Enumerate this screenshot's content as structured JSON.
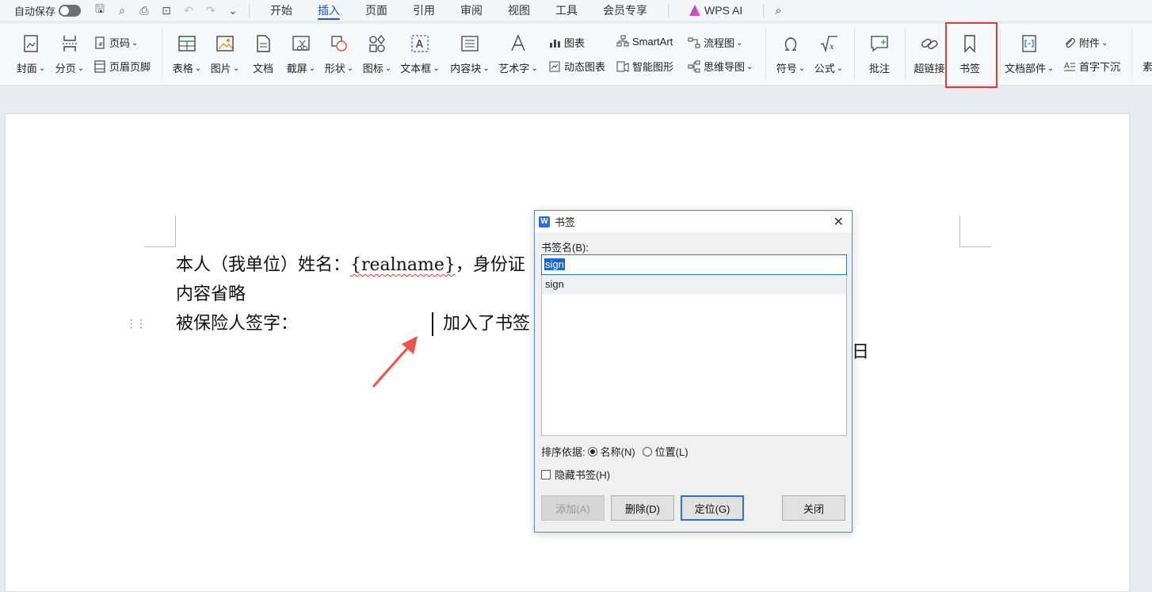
{
  "menubar": {
    "autosave_label": "自动保存",
    "tabs": [
      {
        "label": "开始",
        "active": false
      },
      {
        "label": "插入",
        "active": true
      },
      {
        "label": "页面",
        "active": false
      },
      {
        "label": "引用",
        "active": false
      },
      {
        "label": "审阅",
        "active": false
      },
      {
        "label": "视图",
        "active": false
      },
      {
        "label": "工具",
        "active": false
      },
      {
        "label": "会员专享",
        "active": false
      }
    ],
    "wps_ai_label": "WPS AI"
  },
  "ribbon": {
    "cover": "封面",
    "pagebreak": "分页",
    "page_number": "页码",
    "header_footer": "页眉页脚",
    "table": "表格",
    "picture": "图片",
    "document": "文档",
    "screenshot": "截屏",
    "shape": "形状",
    "icon": "图标",
    "textbox": "文本框",
    "content_block": "内容块",
    "wordart": "艺术字",
    "chart": "图表",
    "dynamic_chart": "动态图表",
    "smartart": "SmartArt",
    "smart_graphic": "智能图形",
    "flowchart": "流程图",
    "mindmap": "思维导图",
    "symbol": "符号",
    "formula": "公式",
    "comment": "批注",
    "hyperlink": "超链接",
    "bookmark": "书签",
    "doc_parts": "文档部件",
    "attachment": "附件",
    "drop_cap": "首字下沉",
    "cut_label": "素"
  },
  "document": {
    "line1_prefix": "本人（我单位）姓名：",
    "line1_field": "{realname}",
    "line1_suffix": "，身份证",
    "line2": "内容省略",
    "line3": "被保险人签字：",
    "bookmark_note": "加入了书签",
    "date_tail": "日"
  },
  "dialog": {
    "title": "书签",
    "name_label": "书签名(B):",
    "name_value": "sign",
    "list_items": [
      "sign"
    ],
    "sort_label": "排序依据:",
    "sort_by_name": "名称(N)",
    "sort_by_position": "位置(L)",
    "sort_selected": "name",
    "hide_label": "隐藏书签(H)",
    "hide_checked": false,
    "btn_add": "添加(A)",
    "btn_delete": "删除(D)",
    "btn_goto": "定位(G)",
    "btn_close": "关闭"
  },
  "colors": {
    "accent": "#1a56d6",
    "highlight_box": "#e53935",
    "arrow": "#f0524a",
    "selection": "#1e63d6"
  }
}
